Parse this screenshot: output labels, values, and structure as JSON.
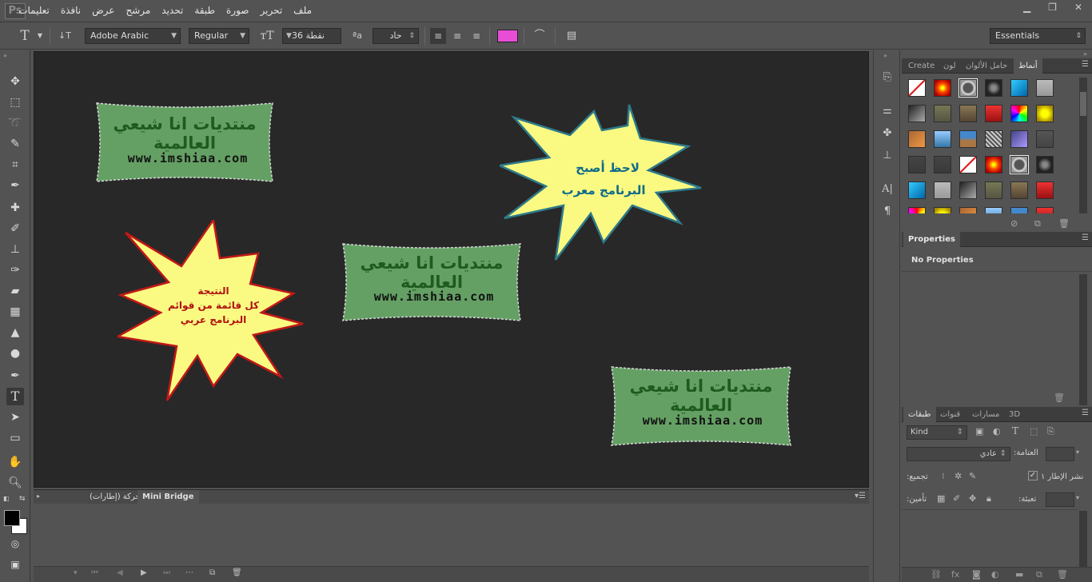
{
  "app": {
    "logo": "Ps"
  },
  "menu": [
    "ملف",
    "تحرير",
    "صورة",
    "طبقة",
    "تحديد",
    "مرشح",
    "عرض",
    "نافذة",
    "تعليمات"
  ],
  "window_controls": [
    "▁",
    "❐",
    "✕"
  ],
  "options": {
    "tool_icon": "T",
    "font_family": "Adobe Arabic",
    "font_style": "Regular",
    "font_size": "نقطة 36",
    "antialias_icon": "ªa",
    "antialias": "حاد",
    "text_color": "#e84dd6",
    "workspace": "Essentials"
  },
  "canvas": {
    "plaque_title": "منتديات انا شيعي العالمية",
    "plaque_url": "www.imshiaa.com",
    "burst_blue": {
      "line1": "لاحظ أصبح",
      "line2": "البرنامج معرب"
    },
    "burst_red": {
      "line1": "النتيجة",
      "line2": "كل قائمة من قوائم",
      "line3": "البرنامج عربي"
    }
  },
  "bottom_panel": {
    "tab_animation": "حركة (إطارات)",
    "tab_minibridge": "Mini Bridge"
  },
  "styles_panel": {
    "tabs": [
      "Create",
      "حامل الألوان",
      "لون",
      "أنماط"
    ],
    "active_tab": "أنماط"
  },
  "properties_panel": {
    "title": "Properties",
    "message": "No Properties"
  },
  "layers_panel": {
    "tabs": [
      "طبقات",
      "قنوات",
      "مسارات",
      "3D"
    ],
    "kind": "Kind",
    "blend_mode": "عادي",
    "opacity_label": "العتامة:",
    "unify_label": "تجميع:",
    "propagate_label": "نشر الإطار ١",
    "lock_label": "تأمين:",
    "fill_label": "تعبئة:"
  },
  "colors": {
    "ui_bg": "#535353",
    "canvas_bg": "#282828",
    "plaque_fill": "#64a064",
    "plaque_text": "#1f5a1f",
    "burst_fill": "#fafa82"
  }
}
